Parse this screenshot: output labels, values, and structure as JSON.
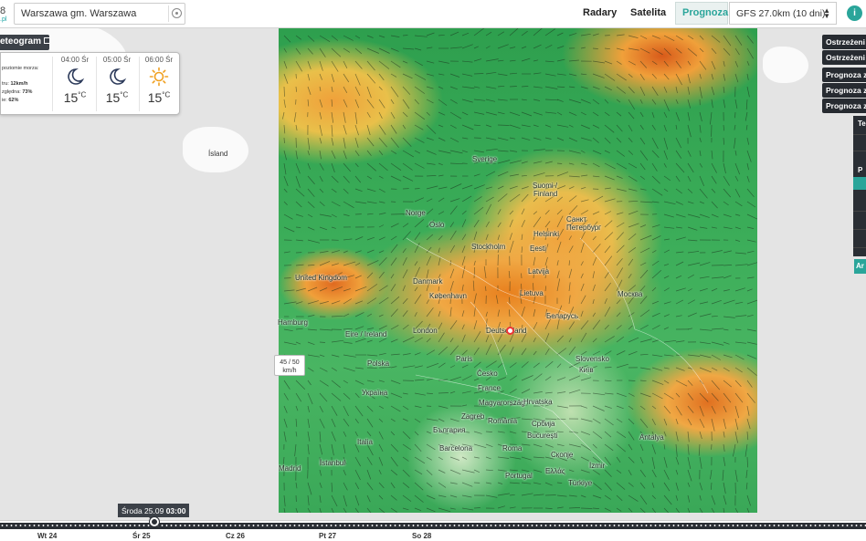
{
  "header": {
    "logo_fragment": "8",
    "logo_domain_fragment": ".pl",
    "search_value": "Warszawa gm. Warszawa",
    "nav": [
      "Radary",
      "Satelita",
      "Prognoza"
    ],
    "active_nav": "Prognoza",
    "model_select": "GFS 27.0km (10 dni)",
    "info_label": "i"
  },
  "meteogram": {
    "button_label": "eteogram"
  },
  "weather": {
    "lines": [
      {
        "text": "poziomie morza:",
        "bold": ""
      },
      {
        "text": "tru: ",
        "bold": "12km/h"
      },
      {
        "text": "zględna: ",
        "bold": "73%"
      },
      {
        "text": "ie: ",
        "bold": "62%"
      }
    ],
    "hours": [
      {
        "time": "04:00 Śr",
        "icon": "moon-icon",
        "temp": "15",
        "unit": "°C"
      },
      {
        "time": "05:00 Śr",
        "icon": "moon-icon",
        "temp": "15",
        "unit": "°C"
      },
      {
        "time": "06:00 Śr",
        "icon": "sun-icon",
        "temp": "15",
        "unit": "°C"
      }
    ]
  },
  "right_panel": {
    "buttons": [
      "Ostrzeżeni",
      "Ostrzeżeni",
      "Prognoza z",
      "Prognoza z",
      "Prognoza z"
    ],
    "panel_labels": [
      "Te",
      "P"
    ],
    "bottom_button": "Ar"
  },
  "map": {
    "labels": [
      {
        "text": "Ísland",
        "ext": true
      },
      {
        "text": "Sverige"
      },
      {
        "text": "Norge"
      },
      {
        "text": "Oslo"
      },
      {
        "text": "Suomi /"
      },
      {
        "text": "Finland"
      },
      {
        "text": "Helsinki"
      },
      {
        "text": "Санкт"
      },
      {
        "text": "Петербург"
      },
      {
        "text": "Stockholm"
      },
      {
        "text": "Eesti"
      },
      {
        "text": "Latvija"
      },
      {
        "text": "Lietuva"
      },
      {
        "text": "Москва"
      },
      {
        "text": "Беларусь"
      },
      {
        "text": "United Kingdom"
      },
      {
        "text": "Danmark"
      },
      {
        "text": "København"
      },
      {
        "text": "Hamburg"
      },
      {
        "text": "Eire / Ireland"
      },
      {
        "text": "London"
      },
      {
        "text": "Deutschland"
      },
      {
        "text": "Polska"
      },
      {
        "text": "Paris"
      },
      {
        "text": "Česko"
      },
      {
        "text": "Slovensko"
      },
      {
        "text": "Київ"
      },
      {
        "text": "Україна"
      },
      {
        "text": "France"
      },
      {
        "text": "Magyarország"
      },
      {
        "text": "Zagreb"
      },
      {
        "text": "Hrvatska"
      },
      {
        "text": "România"
      },
      {
        "text": "Србија"
      },
      {
        "text": "București"
      },
      {
        "text": "България"
      },
      {
        "text": "Italia"
      },
      {
        "text": "Barcelona"
      },
      {
        "text": "Roma"
      },
      {
        "text": "Скопје"
      },
      {
        "text": "İstanbul"
      },
      {
        "text": "Madrid"
      },
      {
        "text": "Portugal"
      },
      {
        "text": "Ελλάς"
      },
      {
        "text": "İzmir"
      },
      {
        "text": "Türkiye"
      },
      {
        "text": "Antalya"
      },
      {
        "text": "საქართველო"
      }
    ],
    "tooltip_line1": "45 / 50",
    "tooltip_line2": "km/h",
    "colors": {
      "calm": "#3aac58",
      "moderate": "#f0a844",
      "strong": "#d85a1a",
      "base": "#e4e4e4"
    }
  },
  "timeline": {
    "current_day": "Środa 25.09",
    "current_time": "03:00",
    "days": [
      "Wt 24",
      "Śr 25",
      "Cz 26",
      "Pt 27",
      "So 28"
    ],
    "progress": 0.18
  }
}
